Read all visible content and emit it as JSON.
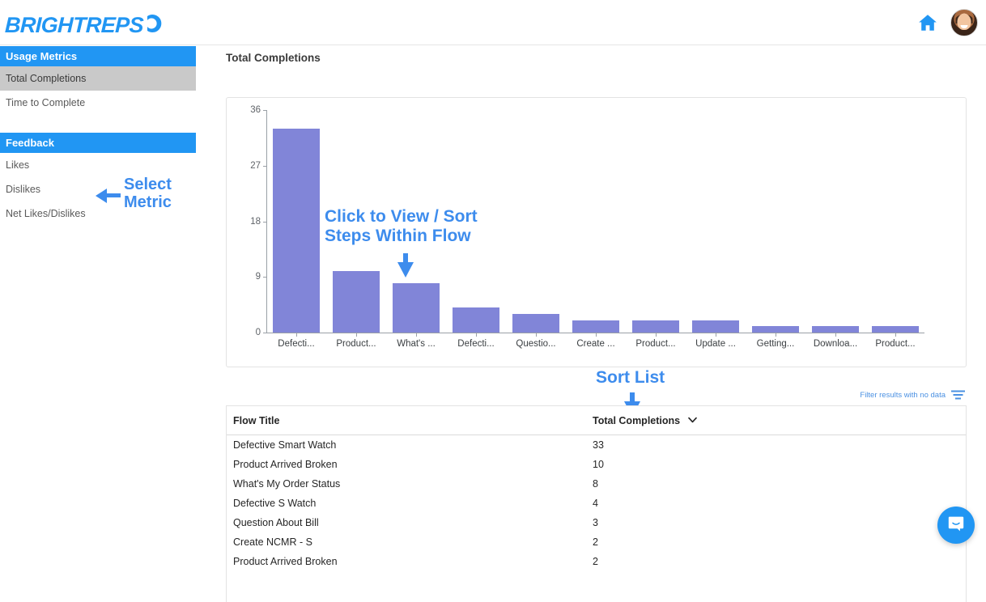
{
  "brand": {
    "logo_text": "BRIGHTREPS",
    "accent_color": "#2196f3",
    "bar_color": "#8185d8",
    "annotation_color": "#3d8ced"
  },
  "topbar": {
    "home_icon": "home-icon",
    "avatar_label": "user-avatar"
  },
  "sidebar": {
    "groups": [
      {
        "header": "Usage Metrics",
        "items": [
          {
            "label": "Total Completions",
            "active": true
          },
          {
            "label": "Time to Complete",
            "active": false
          }
        ]
      },
      {
        "header": "Feedback",
        "items": [
          {
            "label": "Likes",
            "active": false
          },
          {
            "label": "Dislikes",
            "active": false
          },
          {
            "label": "Net Likes/Dislikes",
            "active": false
          }
        ]
      }
    ]
  },
  "annotations": {
    "select_metric": {
      "line1": "Select",
      "line2": "Metric"
    },
    "click_to_view": {
      "line1": "Click to View / Sort",
      "line2": "Steps Within Flow"
    },
    "sort_list": {
      "text": "Sort List"
    }
  },
  "main": {
    "page_title": "Total Completions",
    "filter_label": "Filter results with no data",
    "filter_icon": "filter-icon"
  },
  "table": {
    "columns": [
      "Flow Title",
      "Total Completions"
    ],
    "sort_column": "Total Completions",
    "sort_direction": "desc",
    "sort_caret": "⌄",
    "rows": [
      {
        "title": "Defective Smart Watch",
        "completions": "33"
      },
      {
        "title": "Product Arrived Broken",
        "completions": "10"
      },
      {
        "title": "What's My Order Status",
        "completions": "8"
      },
      {
        "title": "Defective S Watch",
        "completions": "4"
      },
      {
        "title": "Question About Bill",
        "completions": "3"
      },
      {
        "title": "Create NCMR - S",
        "completions": "2"
      },
      {
        "title": "Product Arrived Broken",
        "completions": "2"
      }
    ]
  },
  "chart_data": {
    "type": "bar",
    "title": "Total Completions",
    "xlabel": "",
    "ylabel": "",
    "ylim": [
      0,
      36
    ],
    "yticks": [
      0,
      9,
      18,
      27,
      36
    ],
    "grid": false,
    "legend": false,
    "bar_color": "#8185d8",
    "categories": [
      "Defecti...",
      "Product...",
      "What's ...",
      "Defecti...",
      "Questio...",
      "Create ...",
      "Product...",
      "Update ...",
      "Getting...",
      "Downloa...",
      "Product..."
    ],
    "full_categories": [
      "Defective Smart Watch",
      "Product Arrived Broken",
      "What's My Order Status",
      "Defective S Watch",
      "Question About Bill",
      "Create NCMR - S",
      "Product Arrived Broken",
      "Update ...",
      "Getting ...",
      "Download ...",
      "Product ..."
    ],
    "values": [
      33,
      10,
      8,
      4,
      3,
      2,
      2,
      2,
      1,
      1,
      1
    ]
  }
}
